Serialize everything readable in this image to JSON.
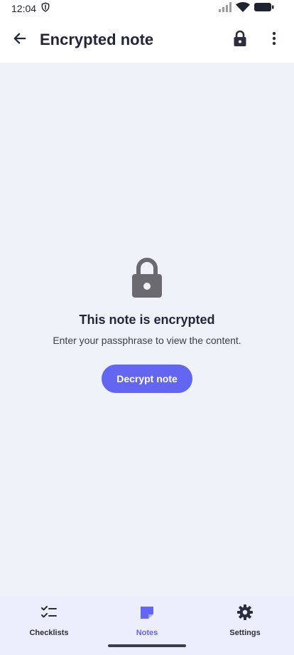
{
  "status_bar": {
    "time": "12:04",
    "icons": [
      "shield-icon",
      "signal-icon",
      "wifi-icon",
      "battery-icon"
    ]
  },
  "app_bar": {
    "title": "Encrypted note",
    "icons": [
      "back-arrow-icon",
      "lock-icon",
      "more-vert-icon"
    ]
  },
  "empty_state": {
    "icon": "lock-icon",
    "title": "This note is encrypted",
    "subtitle": "Enter your passphrase to view the content.",
    "button_label": "Decrypt note"
  },
  "bottom_nav": {
    "items": [
      {
        "label": "Checklists",
        "icon": "checklist-icon",
        "active": false
      },
      {
        "label": "Notes",
        "icon": "note-icon",
        "active": true
      },
      {
        "label": "Settings",
        "icon": "gear-icon",
        "active": false
      }
    ]
  },
  "colors": {
    "accent": "#6366f1",
    "background": "#eff2f8",
    "surface": "#ffffff",
    "nav_background": "#eceffb",
    "icon_gray": "#6a6a70"
  }
}
